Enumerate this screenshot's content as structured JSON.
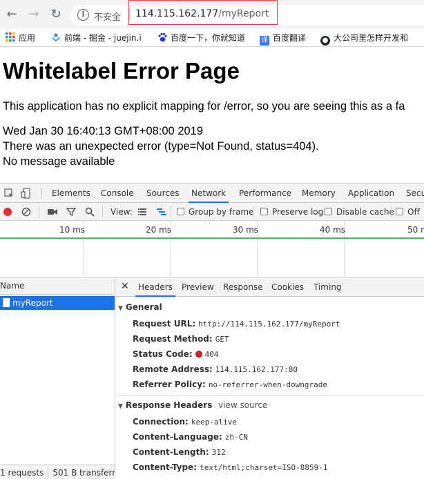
{
  "browser": {
    "address": {
      "security_label": "不安全",
      "url_host": "114.115.162.177",
      "url_path": "/myReport"
    },
    "bookmarks": [
      {
        "label": "应用",
        "icon": "apps-grid-icon"
      },
      {
        "label": "前端 - 掘金 - juejin.i",
        "icon": "juejin-logo-icon"
      },
      {
        "label": "百度一下，你就知道",
        "icon": "baidu-paw-icon"
      },
      {
        "label": "百度翻译",
        "icon": "translate-icon"
      },
      {
        "label": "大公司里怎样开发和",
        "icon": "github-icon"
      }
    ]
  },
  "page": {
    "title": "Whitelabel Error Page",
    "lines": [
      "This application has no explicit mapping for /error, so you are seeing this as a fa",
      "Wed Jan 30 16:40:13 GMT+08:00 2019",
      "There was an unexpected error (type=Not Found, status=404).",
      "No message available"
    ]
  },
  "devtools": {
    "tabs": [
      "Elements",
      "Console",
      "Sources",
      "Network",
      "Performance",
      "Memory",
      "Application",
      "Secu"
    ],
    "active_tab": "Network",
    "toolbar": {
      "view_label": "View:",
      "group_by_frame": "Group by frame",
      "preserve_log": "Preserve log",
      "disable_cache": "Disable cache",
      "offline": "Off"
    },
    "timeline_ticks": [
      "10 ms",
      "20 ms",
      "30 ms",
      "40 ms",
      "50 m"
    ],
    "list": {
      "name_header": "Name",
      "requests": [
        "myReport"
      ],
      "status": [
        "1 requests",
        "501 B transferre..."
      ]
    },
    "detail_tabs": [
      "Headers",
      "Preview",
      "Response",
      "Cookies",
      "Timing"
    ],
    "active_detail_tab": "Headers",
    "general": {
      "title": "General",
      "rows": [
        {
          "key": "Request URL:",
          "value": "http://114.115.162.177/myReport"
        },
        {
          "key": "Request Method:",
          "value": "GET"
        },
        {
          "key": "Status Code:",
          "value": "404"
        },
        {
          "key": "Remote Address:",
          "value": "114.115.162.177:80"
        },
        {
          "key": "Referrer Policy:",
          "value": "no-referrer-when-downgrade"
        }
      ]
    },
    "response_headers": {
      "title": "Response Headers",
      "view_source": "view source",
      "rows": [
        {
          "key": "Connection:",
          "value": "keep-alive"
        },
        {
          "key": "Content-Language:",
          "value": "zh-CN"
        },
        {
          "key": "Content-Length:",
          "value": "312"
        },
        {
          "key": "Content-Type:",
          "value": "text/html;charset=ISO-8859-1"
        }
      ]
    }
  }
}
